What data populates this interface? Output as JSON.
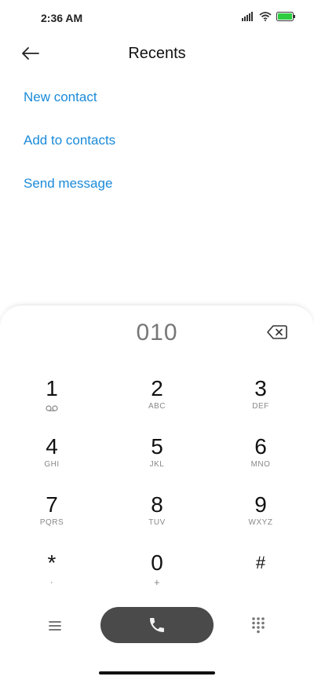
{
  "status": {
    "time": "2:36 AM"
  },
  "header": {
    "title": "Recents"
  },
  "actions": [
    "New contact",
    "Add to contacts",
    "Send message"
  ],
  "dialpad": {
    "number": "010",
    "keys": [
      {
        "digit": "1",
        "letters": ""
      },
      {
        "digit": "2",
        "letters": "ABC"
      },
      {
        "digit": "3",
        "letters": "DEF"
      },
      {
        "digit": "4",
        "letters": "GHI"
      },
      {
        "digit": "5",
        "letters": "JKL"
      },
      {
        "digit": "6",
        "letters": "MNO"
      },
      {
        "digit": "7",
        "letters": "PQRS"
      },
      {
        "digit": "8",
        "letters": "TUV"
      },
      {
        "digit": "9",
        "letters": "WXYZ"
      },
      {
        "digit": "*",
        "letters": ","
      },
      {
        "digit": "0",
        "letters": "+"
      },
      {
        "digit": "#",
        "letters": ""
      }
    ]
  },
  "colors": {
    "accent": "#1a8ad9",
    "call_button": "#4a4a4a",
    "battery": "#2ecc40"
  },
  "icons": [
    "signal-icon",
    "wifi-icon",
    "battery-icon",
    "back-arrow-icon",
    "backspace-icon",
    "voicemail-icon",
    "menu-icon",
    "phone-icon",
    "keypad-icon"
  ]
}
